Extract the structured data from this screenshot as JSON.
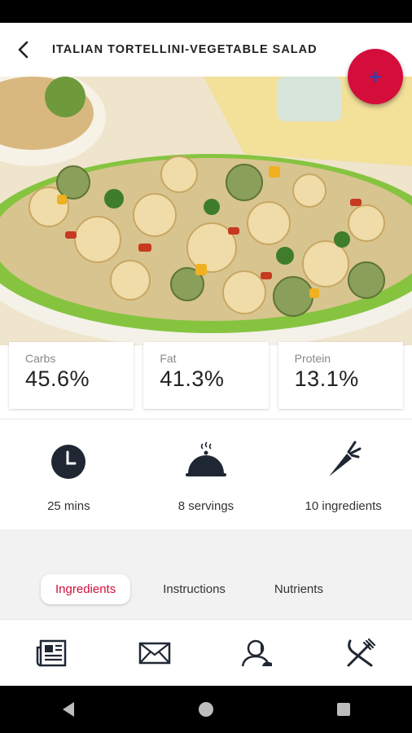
{
  "app_bar": {
    "title": "ITALIAN TORTELLINI-VEGETABLE SALAD",
    "back_icon": "chevron-left-icon"
  },
  "fab": {
    "icon": "plus-icon",
    "label": "+",
    "color": "#d40d3a"
  },
  "macros": [
    {
      "label": "Carbs",
      "value": "45.6%"
    },
    {
      "label": "Fat",
      "value": "41.3%"
    },
    {
      "label": "Protein",
      "value": "13.1%"
    }
  ],
  "stats": {
    "time": {
      "icon": "clock-icon",
      "label": "25 mins"
    },
    "servings": {
      "icon": "serving-cloche-icon",
      "label": "8 servings"
    },
    "ingredients": {
      "icon": "carrot-icon",
      "label": "10 ingredients"
    }
  },
  "tabs": [
    {
      "label": "Ingredients",
      "active": true
    },
    {
      "label": "Instructions",
      "active": false
    },
    {
      "label": "Nutrients",
      "active": false
    }
  ],
  "bottom_nav": [
    {
      "icon": "newspaper-icon"
    },
    {
      "icon": "mail-icon"
    },
    {
      "icon": "profile-icon"
    },
    {
      "icon": "fork-knife-icon"
    }
  ],
  "system_nav": [
    {
      "icon": "back-triangle-icon"
    },
    {
      "icon": "home-circle-icon"
    },
    {
      "icon": "recents-square-icon"
    }
  ],
  "colors": {
    "accent": "#d40d3a",
    "text": "#222222",
    "muted": "#888888",
    "icon": "#1f2733"
  }
}
